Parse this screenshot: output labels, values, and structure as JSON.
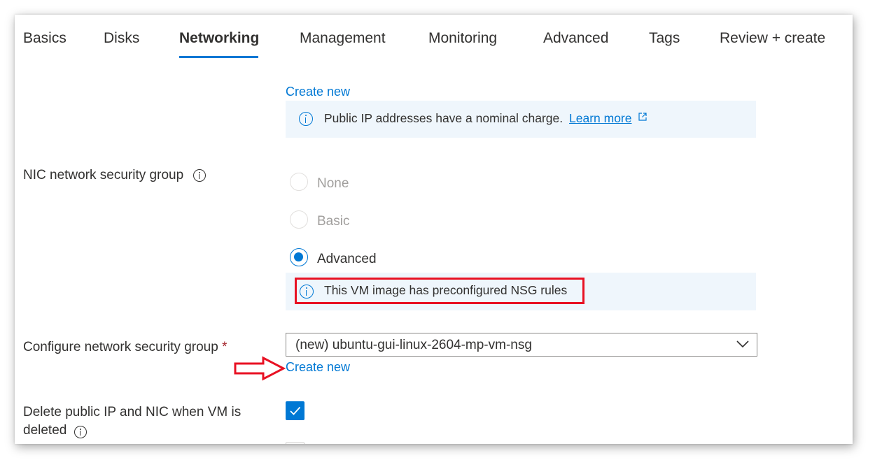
{
  "tabs": [
    {
      "label": "Basics",
      "active": false
    },
    {
      "label": "Disks",
      "active": false
    },
    {
      "label": "Networking",
      "active": true
    },
    {
      "label": "Management",
      "active": false
    },
    {
      "label": "Monitoring",
      "active": false
    },
    {
      "label": "Advanced",
      "active": false
    },
    {
      "label": "Tags",
      "active": false
    },
    {
      "label": "Review + create",
      "active": false
    }
  ],
  "public_ip": {
    "create_new_label": "Create new",
    "info_text": "Public IP addresses have a nominal charge.",
    "learn_more_label": "Learn more"
  },
  "nic_nsg": {
    "label": "NIC network security group",
    "options": [
      {
        "label": "None",
        "selected": false,
        "disabled": true
      },
      {
        "label": "Basic",
        "selected": false,
        "disabled": true
      },
      {
        "label": "Advanced",
        "selected": true,
        "disabled": false
      }
    ],
    "info_text": "This VM image has preconfigured NSG rules"
  },
  "configure_nsg": {
    "label": "Configure network security group",
    "required_marker": "*",
    "selected_value": "(new) ubuntu-gui-linux-2604-mp-vm-nsg",
    "create_new_label": "Create new"
  },
  "delete_option": {
    "label_line1": "Delete public IP and NIC when VM is",
    "label_line2": "deleted",
    "checked": true
  },
  "colors": {
    "accent": "#0078d4",
    "info_background": "#eff6fc",
    "annotation_red": "#e81123"
  }
}
